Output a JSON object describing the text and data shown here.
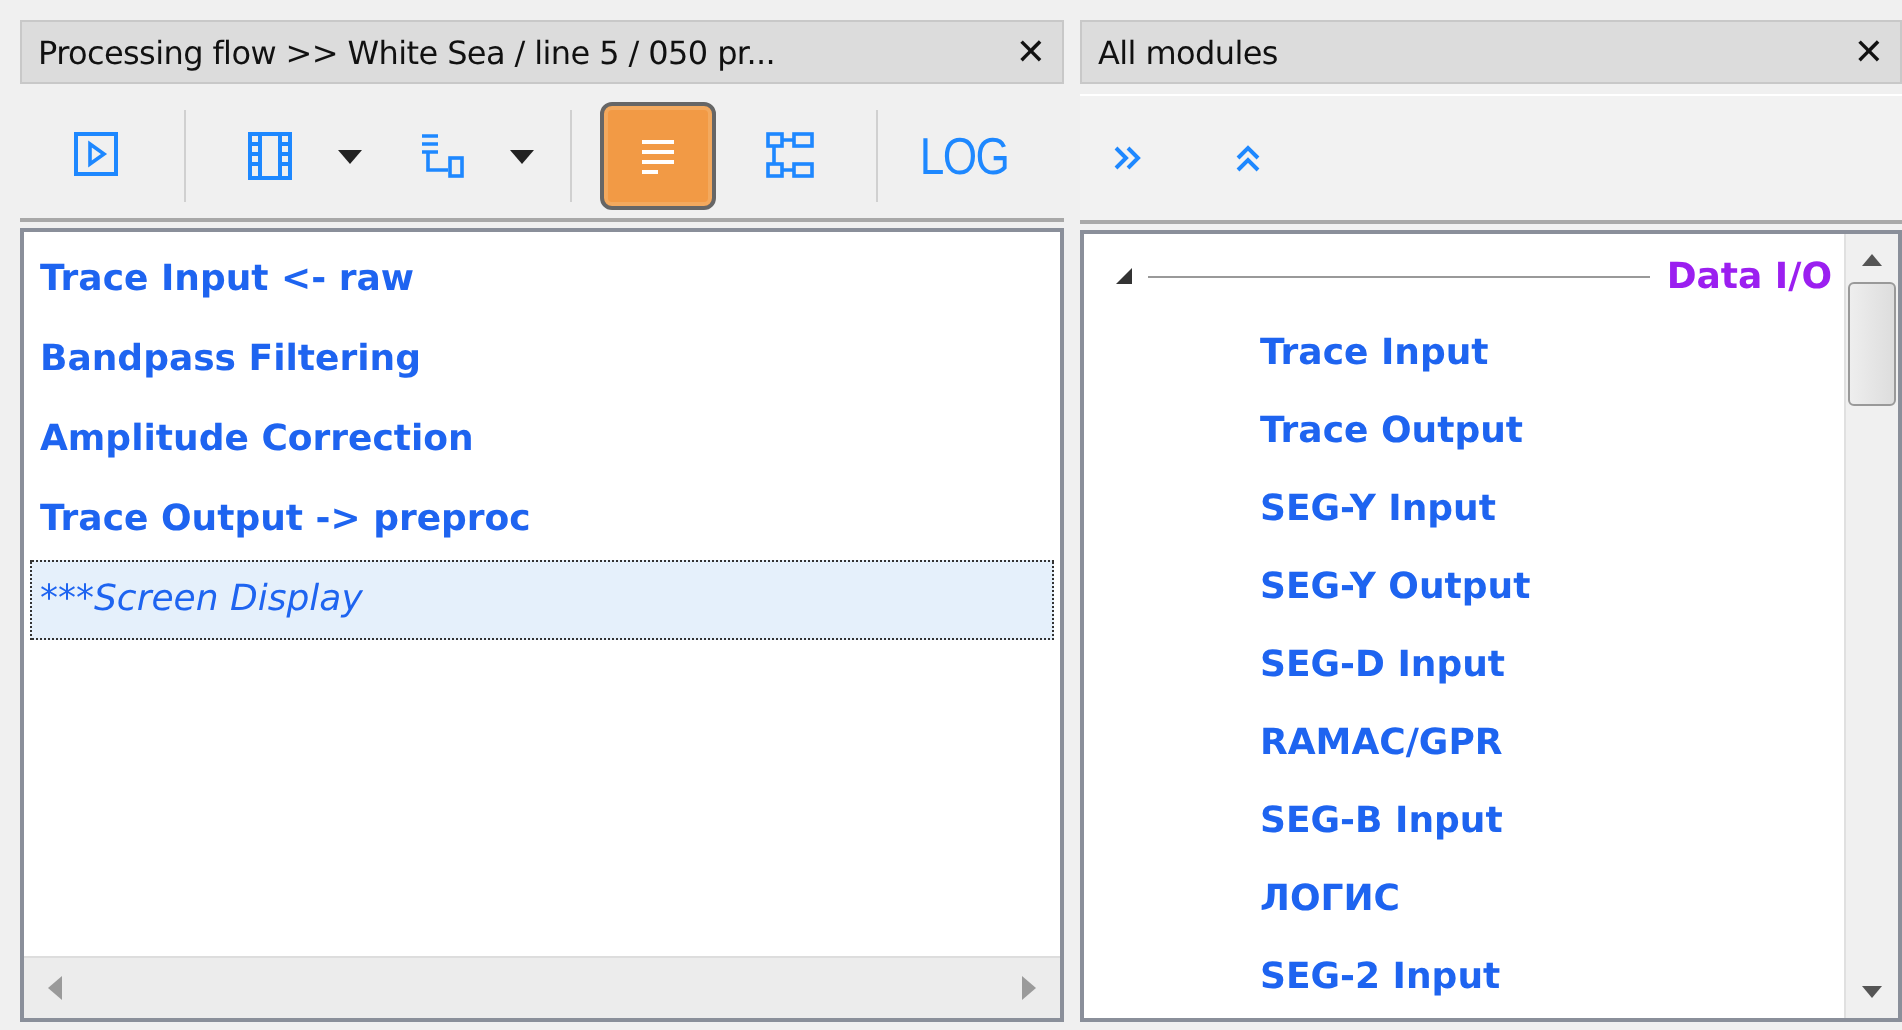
{
  "flow_panel": {
    "title": "Processing flow >> White Sea / line 5 / 050 pr...",
    "close": "✕",
    "toolbar": [
      {
        "kind": "run",
        "selected": false,
        "dropdown": false
      },
      {
        "kind": "film",
        "selected": false,
        "dropdown": true
      },
      {
        "kind": "tree",
        "selected": false,
        "dropdown": true
      },
      {
        "kind": "list",
        "selected": true,
        "dropdown": false
      },
      {
        "kind": "diagram",
        "selected": false,
        "dropdown": false
      },
      {
        "kind": "log",
        "label": "LOG",
        "selected": false,
        "dropdown": false
      }
    ],
    "items": [
      {
        "label": "Trace Input <- raw",
        "disabled": false,
        "selected": false
      },
      {
        "label": "Bandpass Filtering",
        "disabled": false,
        "selected": false
      },
      {
        "label": "Amplitude Correction",
        "disabled": false,
        "selected": false
      },
      {
        "label": "Trace Output -> preproc",
        "disabled": false,
        "selected": false
      },
      {
        "label": "***Screen Display",
        "disabled": true,
        "selected": true
      }
    ]
  },
  "modules_panel": {
    "title": "All modules",
    "close": "✕",
    "toolbar": [
      {
        "kind": "expand"
      },
      {
        "kind": "collapse"
      }
    ],
    "groups": [
      {
        "label": "Data I/O",
        "expanded": true,
        "children": [
          {
            "label": "Trace Input"
          },
          {
            "label": "Trace Output"
          },
          {
            "label": "SEG-Y Input"
          },
          {
            "label": "SEG-Y Output"
          },
          {
            "label": "SEG-D Input"
          },
          {
            "label": "RAMAC/GPR"
          },
          {
            "label": "SEG-B Input"
          },
          {
            "label": "ЛОГИС"
          },
          {
            "label": "SEG-2 Input"
          }
        ]
      }
    ]
  }
}
